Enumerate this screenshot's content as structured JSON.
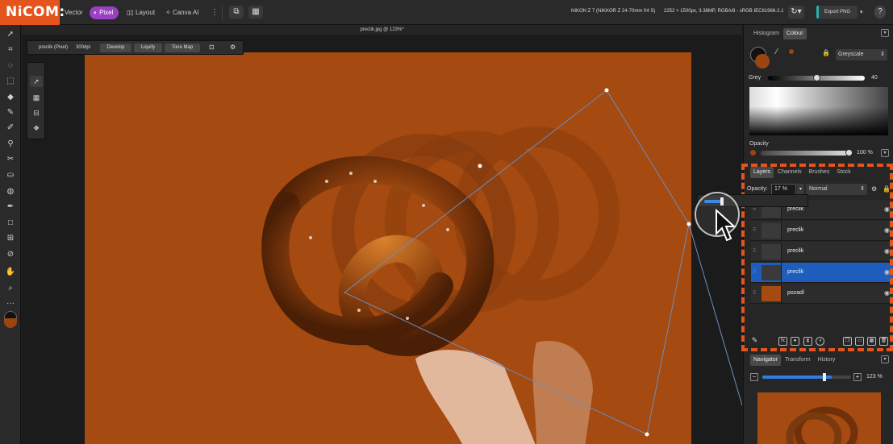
{
  "app": {
    "logo": "NiCOM:"
  },
  "topbar": {
    "personas": [
      {
        "label": "Vector",
        "active": false
      },
      {
        "label": "Pixel",
        "active": true
      },
      {
        "label": "Layout",
        "active": false
      },
      {
        "label": "Canva AI",
        "active": false
      }
    ],
    "camera_info": "NIKON Z 7 (NIKKOR Z 24-70mm f/4 S)",
    "image_info": "2252 × 1500px, 3.38MP, RGBA/8 - sRGB IEC61966-2.1",
    "export_label": "Export PNG",
    "help_icon": "question-icon"
  },
  "document": {
    "title": "preclik.jpg @ 123%*"
  },
  "context_toolbar": {
    "layer": "preclik (Pixel)",
    "dpi": "300dpi",
    "buttons": [
      "Develop",
      "Liquify",
      "Tone Map"
    ]
  },
  "colour_panel": {
    "tabs": [
      "Histogram",
      "Colour"
    ],
    "active_tab": "Colour",
    "mode": "Greyscale",
    "grey_label": "Grey",
    "grey_value": "40",
    "grey_level": 0.5,
    "opacity_label": "Opacity",
    "opacity_value": "100 %",
    "fill_color": "#9c4510"
  },
  "layers_panel": {
    "tabs": [
      "Layers",
      "Channels",
      "Brushes",
      "Stock"
    ],
    "active_tab": "Layers",
    "opacity_label": "Opacity:",
    "opacity_value": "17 %",
    "opacity_level": 0.17,
    "blend_mode": "Normal",
    "layers": [
      {
        "name": "preclik",
        "selected": false
      },
      {
        "name": "preclik",
        "selected": false
      },
      {
        "name": "preclik",
        "selected": false
      },
      {
        "name": "preclik",
        "selected": true
      },
      {
        "name": "pozadí",
        "selected": false
      }
    ]
  },
  "navigator_panel": {
    "tabs": [
      "Navigator",
      "Transform",
      "History"
    ],
    "active_tab": "Navigator",
    "zoom": "123 %",
    "zoom_level": 0.78
  },
  "colors": {
    "accent": "#e4541c",
    "canvas": "#a54a10",
    "selection": "#1f5dbd",
    "pixel_persona": "#9b3fc4"
  }
}
